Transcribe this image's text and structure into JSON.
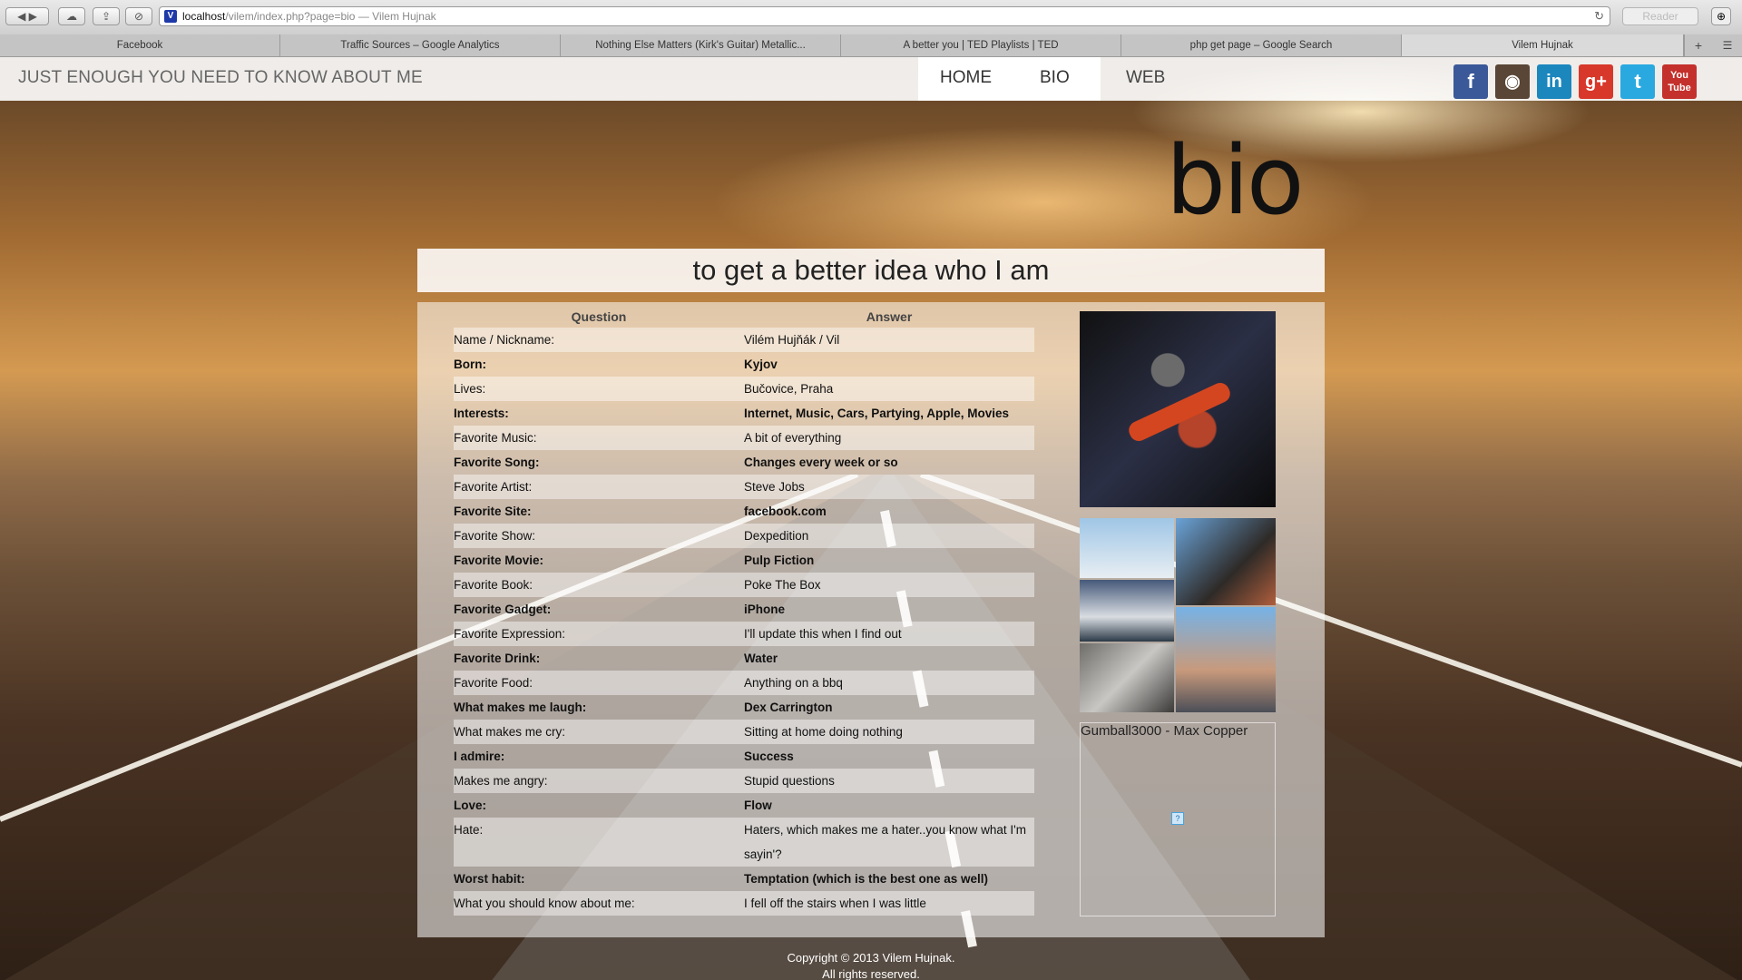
{
  "browser": {
    "url_host": "localhost",
    "url_rest": "/vilem/index.php?page=bio",
    "window_title": "— Vilem Hujnak",
    "reader_label": "Reader",
    "tabs": [
      {
        "label": "Facebook"
      },
      {
        "label": "Traffic Sources – Google Analytics"
      },
      {
        "label": "Nothing Else Matters (Kirk's Guitar) Metallic..."
      },
      {
        "label": "A better you | TED Playlists | TED"
      },
      {
        "label": "php get page – Google Search"
      },
      {
        "label": "Vilem Hujnak"
      }
    ]
  },
  "site": {
    "tagline": "JUST ENOUGH YOU NEED TO KNOW ABOUT ME",
    "nav": {
      "home": "HOME",
      "bio": "BIO",
      "web": "WEB"
    },
    "social": [
      {
        "name": "facebook-icon",
        "glyph": "f",
        "color": "#3b5998"
      },
      {
        "name": "instagram-icon",
        "glyph": "◉",
        "color": "#5a4636"
      },
      {
        "name": "linkedin-icon",
        "glyph": "in",
        "color": "#1c87bd"
      },
      {
        "name": "googleplus-icon",
        "glyph": "g+",
        "color": "#d7382a"
      },
      {
        "name": "twitter-icon",
        "glyph": "t",
        "color": "#2aa9e0"
      },
      {
        "name": "youtube-icon",
        "glyph": "You Tube",
        "color": "#c4302b"
      }
    ]
  },
  "page": {
    "big_title": "bio",
    "subtitle": "to get a better idea who I am",
    "table_headers": {
      "question": "Question",
      "answer": "Answer"
    },
    "rows": [
      {
        "q": "Name / Nickname:",
        "a": "Vilém Hujňák / Vil"
      },
      {
        "q": "Born:",
        "a": "Kyjov"
      },
      {
        "q": "Lives:",
        "a": "Bučovice, Praha"
      },
      {
        "q": "Interests:",
        "a": "Internet, Music, Cars, Partying, Apple, Movies"
      },
      {
        "q": "Favorite Music:",
        "a": "A bit of everything"
      },
      {
        "q": "Favorite Song:",
        "a": "Changes every week or so"
      },
      {
        "q": "Favorite Artist:",
        "a": "Steve Jobs"
      },
      {
        "q": "Favorite Site:",
        "a": "facebook.com"
      },
      {
        "q": "Favorite Show:",
        "a": "Dexpedition"
      },
      {
        "q": "Favorite Movie:",
        "a": "Pulp Fiction"
      },
      {
        "q": "Favorite Book:",
        "a": "Poke The Box"
      },
      {
        "q": "Favorite Gadget:",
        "a": "iPhone"
      },
      {
        "q": "Favorite Expression:",
        "a": "I'll update this when I find out"
      },
      {
        "q": "Favorite Drink:",
        "a": "Water"
      },
      {
        "q": "Favorite Food:",
        "a": "Anything on a bbq"
      },
      {
        "q": "What makes me laugh:",
        "a": "Dex Carrington"
      },
      {
        "q": "What makes me cry:",
        "a": "Sitting at home doing nothing"
      },
      {
        "q": "I admire:",
        "a": "Success"
      },
      {
        "q": "Makes me angry:",
        "a": "Stupid questions"
      },
      {
        "q": "Love:",
        "a": "Flow"
      },
      {
        "q": "Hate:",
        "a": "Haters, which makes me a hater..you know what I'm sayin'?"
      },
      {
        "q": "Worst habit:",
        "a": "Temptation (which is the best one as well)"
      },
      {
        "q": "What you should know about me:",
        "a": "I fell off the stairs when I was little"
      }
    ],
    "video_title": "Gumball3000 - Max Copper",
    "video_placeholder": "?",
    "footer_line1": "Copyright © 2013 Vilem Hujnak.",
    "footer_line2": "All rights reserved."
  }
}
